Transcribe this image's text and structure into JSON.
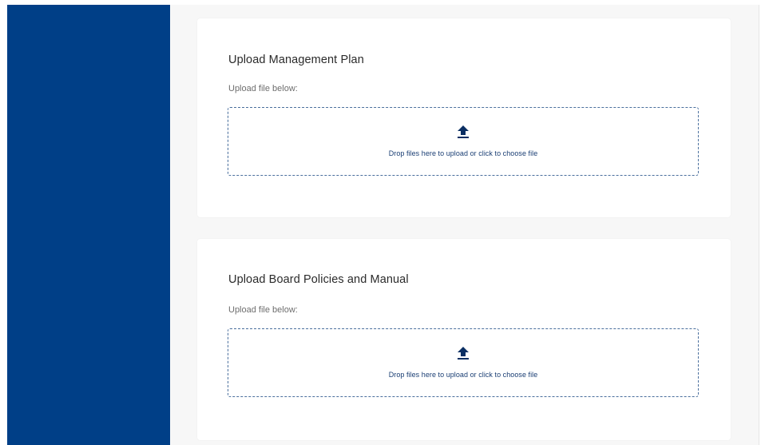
{
  "colors": {
    "sidebar": "#003f87",
    "main_background": "#f7f7f7",
    "card_background": "#ffffff",
    "dropzone_border": "#4a6f9d",
    "dropzone_text": "#1b3f74",
    "icon": "#0b2f63"
  },
  "uploads": [
    {
      "title": "Upload Management Plan",
      "subtitle": "Upload file below:",
      "dropzone_text": "Drop files here to upload or click to choose file",
      "icon": "upload-arrow-icon"
    },
    {
      "title": "Upload Board Policies and Manual",
      "subtitle": "Upload file below:",
      "dropzone_text": "Drop files here to upload or click to choose file",
      "icon": "upload-arrow-icon"
    }
  ]
}
